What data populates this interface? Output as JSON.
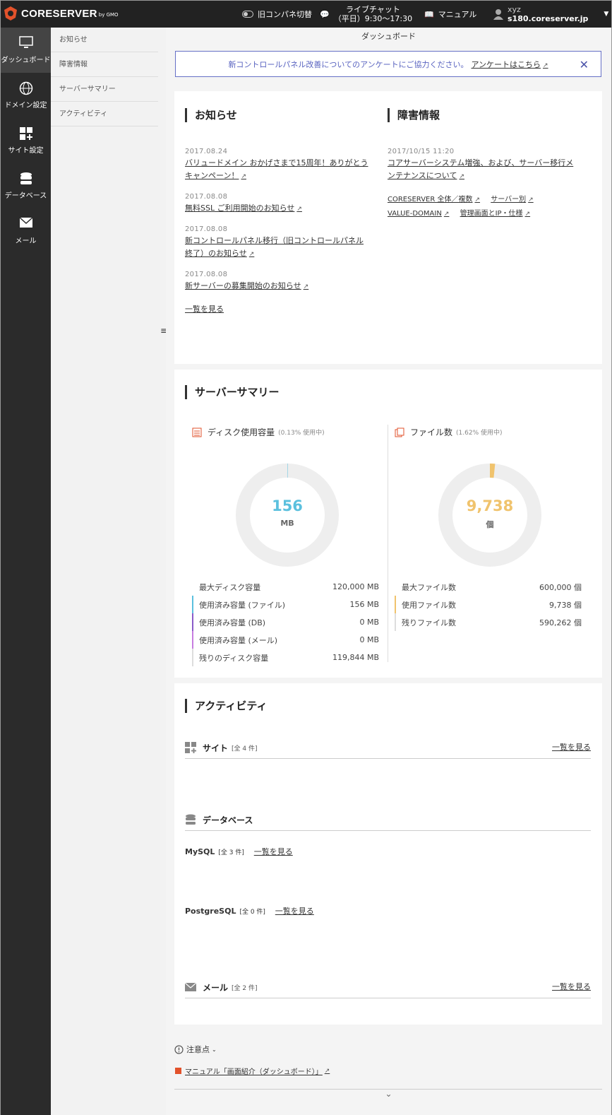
{
  "header": {
    "logo": "CORESERVER",
    "logo_by": "by GMO",
    "old_panel": "旧コンパネ切替",
    "chat_title": "ライブチャット",
    "chat_hours": "（平日）9:30〜17:30",
    "manual": "マニュアル",
    "user": "xyz",
    "server": "s180.coreserver.jp"
  },
  "sidebar": [
    {
      "label": "ダッシュボード",
      "icon": "monitor-icon"
    },
    {
      "label": "ドメイン設定",
      "icon": "globe-icon"
    },
    {
      "label": "サイト設定",
      "icon": "grid-icon"
    },
    {
      "label": "データベース",
      "icon": "database-icon"
    },
    {
      "label": "メール",
      "icon": "mail-icon"
    }
  ],
  "submenu": [
    "お知らせ",
    "障害情報",
    "サーバーサマリー",
    "アクティビティ"
  ],
  "breadcrumb": "ダッシュボード",
  "banner": {
    "text": "新コントロールパネル改善についてのアンケートにご協力ください。",
    "link": "アンケートはこちら"
  },
  "news": {
    "title": "お知らせ",
    "items": [
      {
        "date": "2017.08.24",
        "text": "バリュードメイン おかげさまで15周年！ありがとうキャンペーン！"
      },
      {
        "date": "2017.08.08",
        "text": "無料SSL ご利用開始のお知らせ"
      },
      {
        "date": "2017.08.08",
        "text": "新コントロールパネル移行（旧コントロールパネル終了）のお知らせ"
      },
      {
        "date": "2017.08.08",
        "text": "新サーバーの募集開始のお知らせ"
      }
    ],
    "more": "一覧を見る"
  },
  "incidents": {
    "title": "障害情報",
    "date": "2017/10/15 11:20",
    "text": "コアサーバーシステム増強、および、サーバー移行メンテナンスについて",
    "links": [
      "CORESERVER 全体／複数",
      "サーバー別",
      "VALUE-DOMAIN",
      "管理画面とIP・仕様"
    ]
  },
  "summary": {
    "title": "サーバーサマリー",
    "disk": {
      "label": "ディスク使用容量",
      "pct": "(0.13% 使用中)",
      "fraction": 0.0013,
      "value": "156",
      "unit": "MB",
      "color": "#5bc0de",
      "rows": [
        {
          "label": "最大ディスク容量",
          "value": "120,000 MB",
          "color": ""
        },
        {
          "label": "使用済み容量 (ファイル)",
          "value": "156 MB",
          "color": "#5bc0de"
        },
        {
          "label": "使用済み容量 (DB)",
          "value": "0 MB",
          "color": "#8a5cc9"
        },
        {
          "label": "使用済み容量 (メール)",
          "value": "0 MB",
          "color": "#c77de0"
        },
        {
          "label": "残りのディスク容量",
          "value": "119,844 MB",
          "color": "#ddd"
        }
      ]
    },
    "files": {
      "label": "ファイル数",
      "pct": "(1.62% 使用中)",
      "fraction": 0.0162,
      "value": "9,738",
      "unit": "個",
      "color": "#f0c36d",
      "rows": [
        {
          "label": "最大ファイル数",
          "value": "600,000 個",
          "color": ""
        },
        {
          "label": "使用ファイル数",
          "value": "9,738 個",
          "color": "#f0c36d"
        },
        {
          "label": "残りファイル数",
          "value": "590,262 個",
          "color": "#ddd"
        }
      ]
    }
  },
  "activity": {
    "title": "アクティビティ",
    "site": {
      "label": "サイト",
      "count": "[全 4 件]",
      "more": "一覧を見る"
    },
    "db": {
      "label": "データベース",
      "mysql": "MySQL",
      "mysql_count": "[全 3 件]",
      "pg": "PostgreSQL",
      "pg_count": "[全 0 件]",
      "more": "一覧を見る"
    },
    "mail": {
      "label": "メール",
      "count": "[全 2 件]",
      "more": "一覧を見る"
    }
  },
  "footer": {
    "notes": "注意点",
    "manual": "マニュアル「画面紹介（ダッシュボード）」"
  }
}
